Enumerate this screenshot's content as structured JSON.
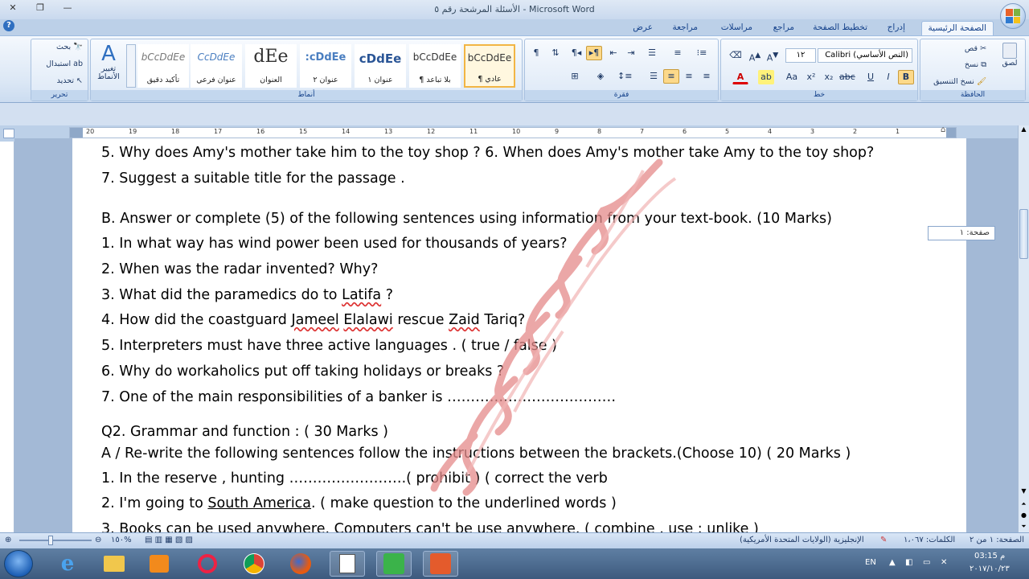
{
  "window": {
    "title": "الأسئلة المرشحة رقم ٥ - Microsoft Word",
    "controls": [
      "—",
      "❐",
      "✕"
    ]
  },
  "help_icon": "?",
  "tabs": [
    {
      "label": "الصفحة الرئيسية",
      "active": true
    },
    {
      "label": "إدراج"
    },
    {
      "label": "تخطيط الصفحة"
    },
    {
      "label": "مراجع"
    },
    {
      "label": "مراسلات"
    },
    {
      "label": "مراجعة"
    },
    {
      "label": "عرض"
    }
  ],
  "ribbon": {
    "clipboard": {
      "label": "الحافظة",
      "paste": "لصق",
      "cut": "قص",
      "copy": "نسخ",
      "format_painter": "نسخ التنسيق"
    },
    "font": {
      "label": "خط",
      "name": "Calibri (النص الأساسي)",
      "size": "١٢"
    },
    "paragraph": {
      "label": "فقرة"
    },
    "styles": {
      "label": "أنماط",
      "change_styles": "تغيير الأنماط",
      "tiles": [
        {
          "sample": "bCcDdEe",
          "name": "¶ عادي",
          "active": true
        },
        {
          "sample": "bCcDdEe",
          "name": "¶ بلا تباعد"
        },
        {
          "sample": "cDdEe",
          "name": "عنوان ١"
        },
        {
          "sample": ":cDdEe",
          "name": "عنوان ٢"
        },
        {
          "sample": "dEe",
          "name": "العنوان"
        },
        {
          "sample": "CcDdEe",
          "name": "عنوان فرعي"
        },
        {
          "sample": "bCcDdEe",
          "name": "تأكيد دقيق"
        }
      ]
    },
    "editing": {
      "label": "تحرير",
      "find": "بحث",
      "replace": "استبدال",
      "select": "تحديد"
    }
  },
  "ruler": {
    "ticks": [
      "20",
      "19",
      "18",
      "17",
      "16",
      "15",
      "14",
      "13",
      "12",
      "11",
      "10",
      "9",
      "8",
      "7",
      "6",
      "5",
      "4",
      "3",
      "2",
      "1"
    ]
  },
  "document": {
    "lines": [
      "5. Why does Amy's mother take him to the toy shop ?     6. When does Amy's mother take  Amy to the toy shop?",
      "7. Suggest a suitable title for the passage ."
    ],
    "sectionB": {
      "heading": "B. Answer or complete (5) of the following sentences using information from your text-book.     (10 Marks)",
      "q1": "1. In what  way has wind power been used for thousands of years?",
      "q2": "2. When was the radar invented? Why?",
      "q3_pre": "3. What did the paramedics do to ",
      "q3_name": "Latifa",
      "q3_post": " ?",
      "q4_pre": "4. How did the coastguard ",
      "q4_n1": "Jameel",
      "q4_n2": "Elalawi",
      "q4_mid": " rescue ",
      "q4_n3": "Zaid",
      "q4_post": " Tariq?",
      "q5": "5. Interpreters must have three active languages . ( true / false )",
      "q6": "6. Why do workaholics put off taking holidays or breaks ?",
      "q7": "7. One of the main responsibilities of a banker is ………………………………"
    },
    "q2": {
      "heading": "Q2. Grammar  and function  : ( 30 Marks  )",
      "sub": " A / Re-write the following  sentences  follow the instructions  between the brackets.(Choose  10)  ( 20 Marks  )",
      "l1": " 1. In the reserve , hunting  …………………….( prohibit ) ( correct the verb",
      "l2_pre": "2. I'm going to ",
      "l2_u": "South America",
      "l2_post": ".   ( make question to the underlined words )",
      "l3": "3. Books can be used anywhere. Computers can't be use anywhere.        ( combine , use : unlike )"
    }
  },
  "page_tooltip": "صفحة: ١",
  "status": {
    "page": "الصفحة: ١ من ٢",
    "words": "الكلمات: ١،٠٦٧",
    "language": "الإنجليزية (الولايات المتحدة الأمريكية)",
    "zoom": "١٥٠%"
  },
  "taskbar": {
    "lang": "EN",
    "time": "03:15 م",
    "date": "٢٠١٧/١٠/٢٣"
  },
  "colors": {
    "ribbon_accent": "#15428b",
    "watermark": "#e5a0a0"
  }
}
